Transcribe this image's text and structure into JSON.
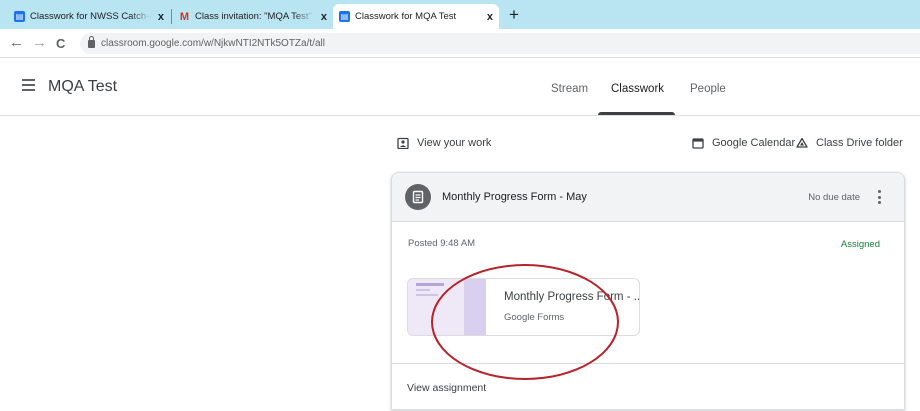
{
  "browser": {
    "tabs": [
      {
        "label": "Classwork for NWSS Catch-A-Cal",
        "icon": "classroom-icon",
        "close": "x"
      },
      {
        "label": "Class invitation: \"MQA Test\" - no",
        "icon": "gmail-icon",
        "close": "x"
      },
      {
        "label": "Classwork for MQA Test",
        "icon": "classroom-icon",
        "close": "x"
      }
    ],
    "new_tab": "+",
    "nav": {
      "back": "←",
      "forward": "→",
      "reload": "C"
    },
    "url": "classroom.google.com/w/NjkwNTI2NTk5OTZa/t/all"
  },
  "app": {
    "class_name": "MQA Test",
    "nav_tabs": [
      {
        "label": "Stream"
      },
      {
        "label": "Classwork"
      },
      {
        "label": "People"
      }
    ],
    "active_tab": "Classwork"
  },
  "links": {
    "view_work": "View your work",
    "calendar": "Google Calendar",
    "drive": "Class Drive folder"
  },
  "assignment": {
    "title": "Monthly Progress Form - May",
    "due": "No due date",
    "posted": "Posted 9:48 AM",
    "status": "Assigned",
    "status_color": "#188038",
    "attachment": {
      "title": "Monthly Progress Form - ...",
      "type": "Google Forms"
    },
    "view_label": "View assignment"
  },
  "colors": {
    "tabstrip": "#b9e4f2",
    "annotation": "#b7232b"
  }
}
